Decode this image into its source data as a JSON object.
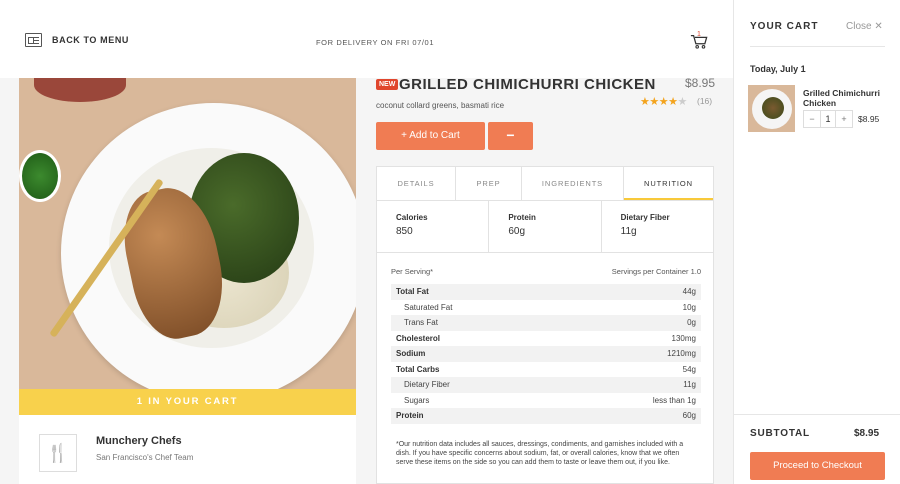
{
  "header": {
    "back_label": "BACK TO MENU",
    "delivery_text": "FOR DELIVERY ON FRI 07/01",
    "cart_count": "1",
    "back_icon": "menu-icon",
    "cart_icon": "shopping-cart-icon"
  },
  "product": {
    "badge": "NEW",
    "name": "GRILLED CHIMICHURRI CHICKEN",
    "price": "$8.95",
    "description": "coconut collard greens, basmati rice",
    "rating": 4,
    "rating_max": 5,
    "review_count": "(16)",
    "in_cart_banner": "1 IN YOUR CART",
    "add_label": "+ Add to Cart",
    "remove_label": "−"
  },
  "chef": {
    "name": "Munchery Chefs",
    "team": "San Francisco's Chef Team",
    "icon": "fork-knife-icon"
  },
  "tabs": [
    {
      "label": "DETAILS"
    },
    {
      "label": "PREP"
    },
    {
      "label": "INGREDIENTS"
    },
    {
      "label": "NUTRITION",
      "active": true
    }
  ],
  "macros": [
    {
      "label": "Calories",
      "value": "850"
    },
    {
      "label": "Protein",
      "value": "60g"
    },
    {
      "label": "Dietary Fiber",
      "value": "11g"
    }
  ],
  "nutrition": {
    "per_serving": "Per Serving*",
    "servings": "Servings per Container 1.0",
    "rows": [
      {
        "k": "Total Fat",
        "v": "44g",
        "bold": true
      },
      {
        "k": "Saturated Fat",
        "v": "10g",
        "indent": true
      },
      {
        "k": "Trans Fat",
        "v": "0g",
        "indent": true
      },
      {
        "k": "Cholesterol",
        "v": "130mg",
        "bold": true
      },
      {
        "k": "Sodium",
        "v": "1210mg",
        "bold": true
      },
      {
        "k": "Total Carbs",
        "v": "54g",
        "bold": true
      },
      {
        "k": "Dietary Fiber",
        "v": "11g",
        "indent": true
      },
      {
        "k": "Sugars",
        "v": "less than 1g",
        "indent": true
      },
      {
        "k": "Protein",
        "v": "60g",
        "bold": true
      }
    ],
    "note": "*Our nutrition data includes all sauces, dressings, condiments, and garnishes included with a dish. If you have specific concerns about sodium, fat, or overall calories, know that we often serve these items on the side so you can add them to taste or leave them out, if you like."
  },
  "cart": {
    "title": "YOUR CART",
    "close_label": "Close ✕",
    "date": "Today, July 1",
    "item_name": "Grilled Chimichurri Chicken",
    "qty_minus": "−",
    "qty": "1",
    "qty_plus": "+",
    "item_price": "$8.95",
    "subtotal_label": "SUBTOTAL",
    "subtotal": "$8.95",
    "checkout_label": "Proceed to Checkout"
  },
  "colors": {
    "accent": "#f07c53",
    "banner": "#f8d14c",
    "badge": "#e0462d",
    "stars": "#f3a31c"
  }
}
